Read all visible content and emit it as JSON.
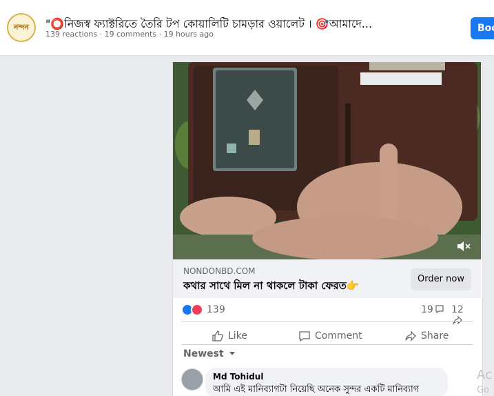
{
  "post": {
    "page_avatar_text": "নন্দন",
    "title": "\"⭕নিজস্ব ফ্যাক্টরিতে তৈরি টপ কোয়ালিটি চামড়ার ওয়ালেট । 🎯আমাদে...",
    "meta": "139 reactions · 19 comments · 19 hours ago",
    "boost_label": "Boost"
  },
  "link": {
    "domain": "NONDONBD.COM",
    "title": "কথার সাথে মিল না থাকলে টাকা ফেরত👉",
    "cta_label": "Order now"
  },
  "stats": {
    "reactions": "139",
    "comments": "19",
    "shares": "12"
  },
  "actions": {
    "like": "Like",
    "comment": "Comment",
    "share": "Share"
  },
  "comments": {
    "sort_label": "Newest",
    "items": [
      {
        "author": "Md Tohidul",
        "text": "আমি এই মানিব্যাগটা নিয়েছি অনেক সুন্দর একটি মানিব্যাগ"
      }
    ]
  },
  "watermark": {
    "line1": "Ac",
    "line2": "Go"
  },
  "colors": {
    "accent": "#1877f2",
    "love": "#f33e58"
  }
}
